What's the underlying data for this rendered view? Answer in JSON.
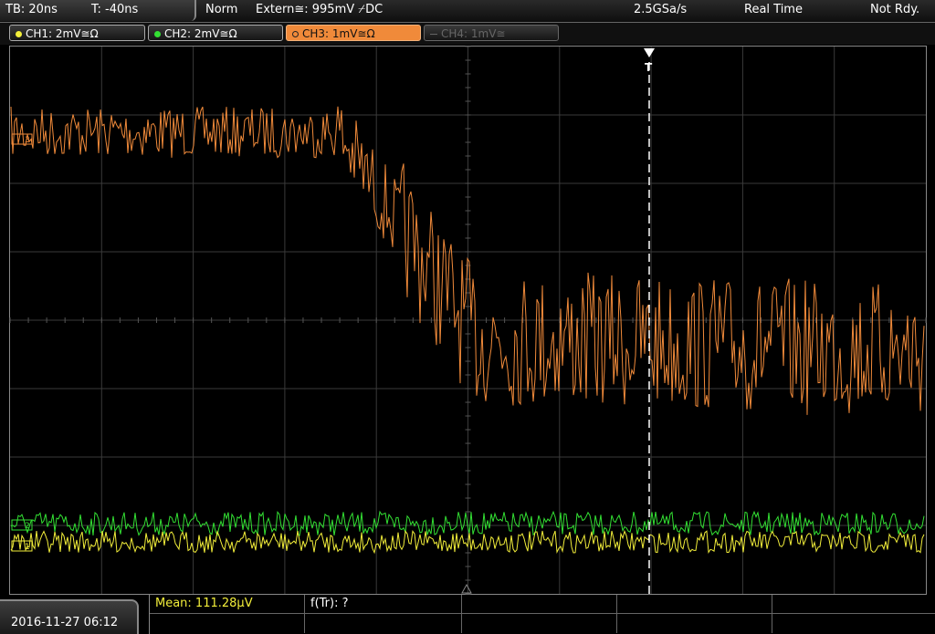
{
  "header": {
    "timebase": "TB: 20ns",
    "trigger_offset": "T: -40ns",
    "trigger_mode": "Norm",
    "trigger_source": "Extern≅: 995mV ⌿DC",
    "sample_rate": "2.5GSa/s",
    "acq_mode": "Real Time",
    "status": "Not Rdy."
  },
  "channels": [
    {
      "label": "CH1: 2mV≅Ω",
      "color": "#f2ee3a",
      "state": "on"
    },
    {
      "label": "CH2: 2mV≅Ω",
      "color": "#33e033",
      "state": "on"
    },
    {
      "label": "CH3: 1mV≅Ω",
      "color": "#f08a3a",
      "state": "active"
    },
    {
      "label": "CH4: 1mV≅",
      "color": "#666666",
      "state": "off"
    }
  ],
  "markers": {
    "trigger": "T",
    "ch3": "3",
    "ch2": "2",
    "ch1": "1"
  },
  "footer": {
    "datetime": "2016-11-27 06:12",
    "mean_label": "Mean: 111.28µV",
    "ftr_label": "f(Tr): ?"
  },
  "colors": {
    "ch1": "#f2ee3a",
    "ch2": "#33e033",
    "ch3": "#f08a3a",
    "grid": "#3a3a3a",
    "trigger_line": "#ffffff"
  }
}
